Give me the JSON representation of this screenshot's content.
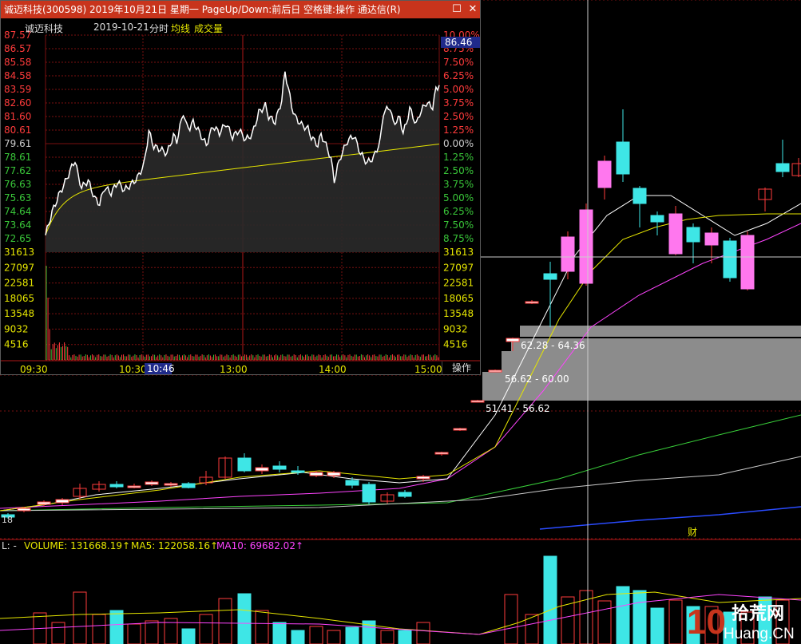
{
  "window": {
    "title": "诚迈科技(300598)  2019年10月21日  星期一  PageUp/Down:前后日  空格键:操作  通达信(R)",
    "maximize_label": "☐",
    "close_label": "✕"
  },
  "intraday": {
    "stock_name": "诚迈科技",
    "date": "2019-10-21",
    "mode": "分时",
    "avg_legend": "均线",
    "vol_legend": "成交量",
    "current_price_badge": "86.46",
    "price_ticks_left": [
      "87.57",
      "86.57",
      "85.58",
      "84.58",
      "83.59",
      "82.60",
      "81.60",
      "80.61",
      "79.61",
      "78.61",
      "77.62",
      "76.63",
      "75.63",
      "74.64",
      "73.64",
      "72.65"
    ],
    "pct_ticks_right": [
      "10.00%",
      "8.75%",
      "7.50%",
      "6.25%",
      "5.00%",
      "3.75%",
      "2.50%",
      "1.25%",
      "0.00%",
      "1.25%",
      "2.50%",
      "3.75%",
      "5.00%",
      "6.25%",
      "7.50%",
      "8.75%"
    ],
    "volume_ticks": [
      "31613",
      "27097",
      "22581",
      "18065",
      "13548",
      "9032",
      "4516"
    ],
    "time_ticks": [
      "09:30",
      "10:30",
      "13:00",
      "14:00",
      "15:00"
    ],
    "cursor_time": "10:46",
    "op_button": "操作",
    "colors": {
      "up": "#ff3b3b",
      "down": "#39c639",
      "flat": "#cccccc",
      "price_line": "#ffffff",
      "avg_line": "#e6e600",
      "grid": "#7a1010"
    }
  },
  "daily_chart": {
    "price_band_labels": [
      "62.28 - 64.36",
      "56.62 - 60.00",
      "51.41 - 56.62"
    ],
    "left_edge_label": "18",
    "event_marker": "财"
  },
  "volume_panel": {
    "prefix": "L: -",
    "volume_label": "VOLUME: 131668.19↑",
    "ma5_label": "MA5: 122058.16↑",
    "ma10_label": "MA10: 69682.02↑"
  },
  "watermark": {
    "text1": "拾荒网",
    "text2": "Huang.CN",
    "num": "10"
  }
}
